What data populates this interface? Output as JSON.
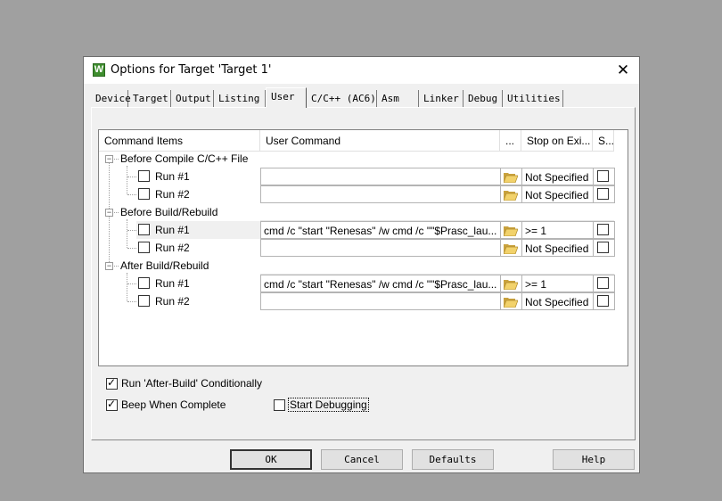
{
  "window": {
    "title": "Options for Target 'Target 1'",
    "app_icon_letter": "W",
    "close_glyph": "✕"
  },
  "tabs": [
    {
      "label": "Device"
    },
    {
      "label": "Target"
    },
    {
      "label": "Output"
    },
    {
      "label": "Listing"
    },
    {
      "label": "User",
      "active": true
    },
    {
      "label": "C/C++ (AC6)"
    },
    {
      "label": "Asm"
    },
    {
      "label": "Linker"
    },
    {
      "label": "Debug"
    },
    {
      "label": "Utilities"
    }
  ],
  "grid": {
    "headers": {
      "command_items": "Command Items",
      "user_command": "User Command",
      "browse": "...",
      "stop_on_exit": "Stop on Exi...",
      "s": "S..."
    },
    "groups": [
      {
        "label": "Before Compile C/C++ File",
        "rows": [
          {
            "label": "Run #1",
            "checked": false,
            "command": "",
            "stop": "Not Specified",
            "s_checked": false
          },
          {
            "label": "Run #2",
            "checked": false,
            "command": "",
            "stop": "Not Specified",
            "s_checked": false
          }
        ]
      },
      {
        "label": "Before Build/Rebuild",
        "rows": [
          {
            "label": "Run #1",
            "checked": false,
            "command": "cmd /c \"start \"Renesas\" /w cmd /c \"\"$Prasc_lau...",
            "stop": ">= 1",
            "s_checked": false,
            "highlighted": true
          },
          {
            "label": "Run #2",
            "checked": false,
            "command": "",
            "stop": "Not Specified",
            "s_checked": false
          }
        ]
      },
      {
        "label": "After Build/Rebuild",
        "rows": [
          {
            "label": "Run #1",
            "checked": false,
            "command": "cmd /c \"start \"Renesas\" /w cmd /c \"\"$Prasc_lau...",
            "stop": ">= 1",
            "s_checked": false
          },
          {
            "label": "Run #2",
            "checked": false,
            "command": "",
            "stop": "Not Specified",
            "s_checked": false
          }
        ]
      }
    ],
    "expander_glyph": "−",
    "folder_icon": "open-folder-icon"
  },
  "options": {
    "run_after_build": {
      "label": "Run 'After-Build' Conditionally",
      "checked": true
    },
    "beep_when_complete": {
      "label": "Beep When Complete",
      "checked": true
    },
    "start_debugging": {
      "label": "Start Debugging",
      "checked": false
    }
  },
  "buttons": {
    "ok": "OK",
    "cancel": "Cancel",
    "defaults": "Defaults",
    "help": "Help"
  },
  "colors": {
    "desktop": "#a0a0a0",
    "dialog_bg": "#f0f0f0",
    "highlight_row": "#f0f0f0",
    "folder_yellow": "#e8c25a"
  }
}
